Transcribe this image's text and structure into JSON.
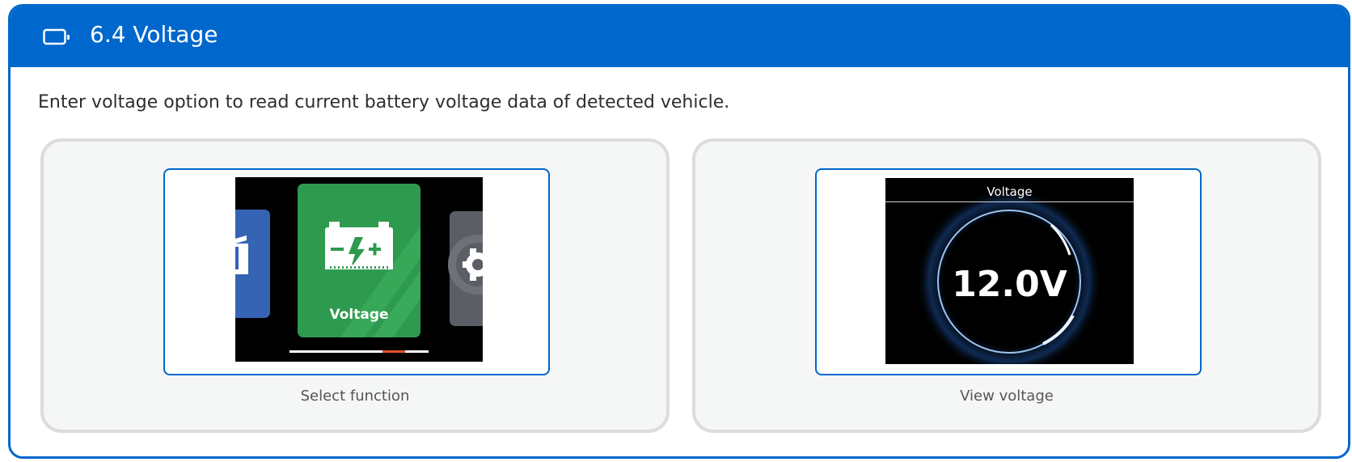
{
  "header": {
    "title": "6.4 Voltage",
    "icon": "battery-icon",
    "background": "#0067cc"
  },
  "description": "Enter voltage option to read current battery voltage data of detected vehicle.",
  "steps": [
    {
      "caption": "Select function",
      "screen": {
        "tile_label": "Voltage",
        "tile_color": "#2e9a4f",
        "tile_icon": "battery-charge-icon"
      }
    },
    {
      "caption": "View voltage",
      "screen": {
        "title": "Voltage",
        "value": "12.0V"
      }
    }
  ]
}
